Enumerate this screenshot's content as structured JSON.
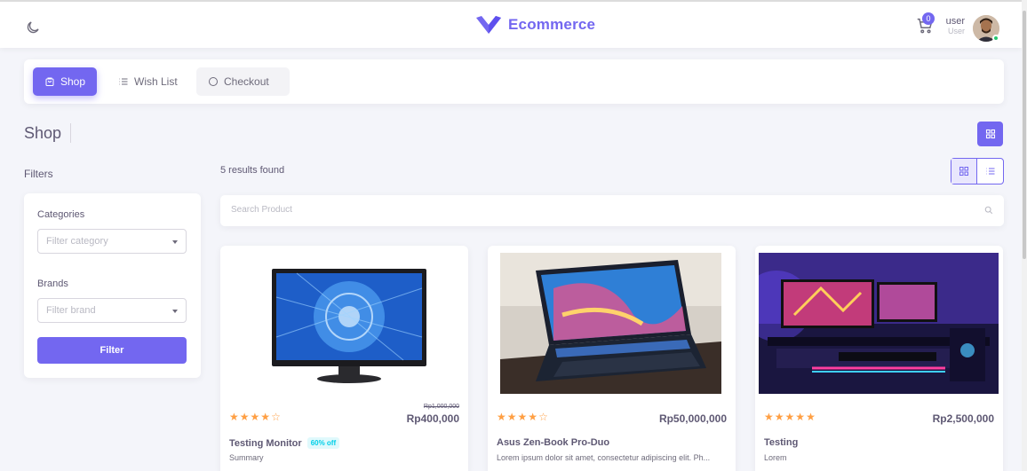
{
  "colors": {
    "accent": "#7367f0",
    "star": "#ff9f43",
    "online": "#28c76f",
    "discount": "#00cfe8"
  },
  "header": {
    "brand": "Ecommerce",
    "cart_count": "0",
    "user_name": "user",
    "user_role": "User",
    "theme_icon": "moon-icon"
  },
  "tabs": [
    {
      "label": "Shop",
      "icon": "shopping-bag-icon",
      "active": true
    },
    {
      "label": "Wish List",
      "icon": "list-icon",
      "active": false
    },
    {
      "label": "Checkout",
      "icon": "circle-icon",
      "active": false
    }
  ],
  "page": {
    "title": "Shop"
  },
  "filters": {
    "title": "Filters",
    "categories_label": "Categories",
    "categories_placeholder": "Filter category",
    "brands_label": "Brands",
    "brands_placeholder": "Filter brand",
    "button": "Filter"
  },
  "results": {
    "text": "5 results found"
  },
  "search": {
    "placeholder": "Search Product"
  },
  "products": [
    {
      "name": "Testing Monitor",
      "badge": "60% off",
      "old_price": "Rp1,000,000",
      "price": "Rp400,000",
      "rating": 4,
      "description": "Summary"
    },
    {
      "name": "Asus Zen-Book Pro-Duo",
      "badge": "",
      "old_price": "",
      "price": "Rp50,000,000",
      "rating": 4,
      "description": "Lorem ipsum dolor sit amet, consectetur adipiscing elit. Ph..."
    },
    {
      "name": "Testing",
      "badge": "",
      "old_price": "",
      "price": "Rp2,500,000",
      "rating": 5,
      "description": "Lorem"
    }
  ]
}
